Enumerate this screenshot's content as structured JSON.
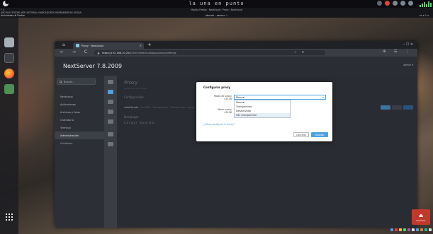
{
  "topbar": {
    "clock": "la una en punto"
  },
  "menubar": {
    "row1": "⠿ 0",
    "row2": "ARCHIVO  EDITAR  VER  HISTORIAL  MARCADORES  HERRAMIENTAS  AYUDA",
    "row3": "Actividades    ⚙ Firefox",
    "center_top": "Mozilla Firefox · Nextcloud · Proxy  |  Nextcloud",
    "center_bottom": "ubuntu · server  ☆",
    "right": "es  ▾  ⏻  ▾"
  },
  "browser": {
    "tab_title": "Proxy · Nextcloud",
    "tab_close": "×",
    "new_tab": "+",
    "url_host": "https://192.168.10.254",
    "url_path": "/2050/nextcloud/apps/proxy/settings",
    "nav_buttons": "← → C",
    "url_right": "☆  ⟳",
    "nav_right": "⊕  ☰  ⋮",
    "window_controls": "–  ☐  ×"
  },
  "nextcloud": {
    "brand": "NextServer 7.8.2009",
    "user": "admin ▾",
    "search_placeholder": "Buscar...",
    "menu": [
      {
        "label": "Nextcloud"
      },
      {
        "label": "Aplicaciones"
      },
      {
        "label": "Archivos y fotos"
      },
      {
        "label": "Calendario"
      },
      {
        "label": "Terminal"
      },
      {
        "label": "Administración"
      },
      {
        "label": "Utilidades"
      }
    ],
    "page_title": "Proxy",
    "page_subtitle": "Ajustes de proxy web",
    "config_label": "Configuración",
    "row_name": "webfiltrado",
    "row_url": "en 3128 · Transparente · Filtrado web · proxy",
    "deploy_label": "Desplegar",
    "deploy_buttons": "Cargar    Guardar"
  },
  "modal": {
    "title": "Configurar proxy",
    "mode_label_1": "Modo de proxy",
    "mode_label_2": "v3128",
    "mode_label_3": "Modo proxy",
    "mode_label_4": "v3128",
    "selected": "Manual",
    "options": [
      "Manual",
      "Transparente",
      "Desactivado",
      "SSL transparente"
    ],
    "link": "¿Cómo configurar el proxy?",
    "cancel": "Cancelar",
    "save": "Guardar"
  },
  "corner": {
    "glyph": "⏏",
    "caption": "Expulsar"
  },
  "colors": {
    "accent": "#4ea1e2",
    "sidebar_active": "#3c4047",
    "tray_red": "#e0423a"
  }
}
